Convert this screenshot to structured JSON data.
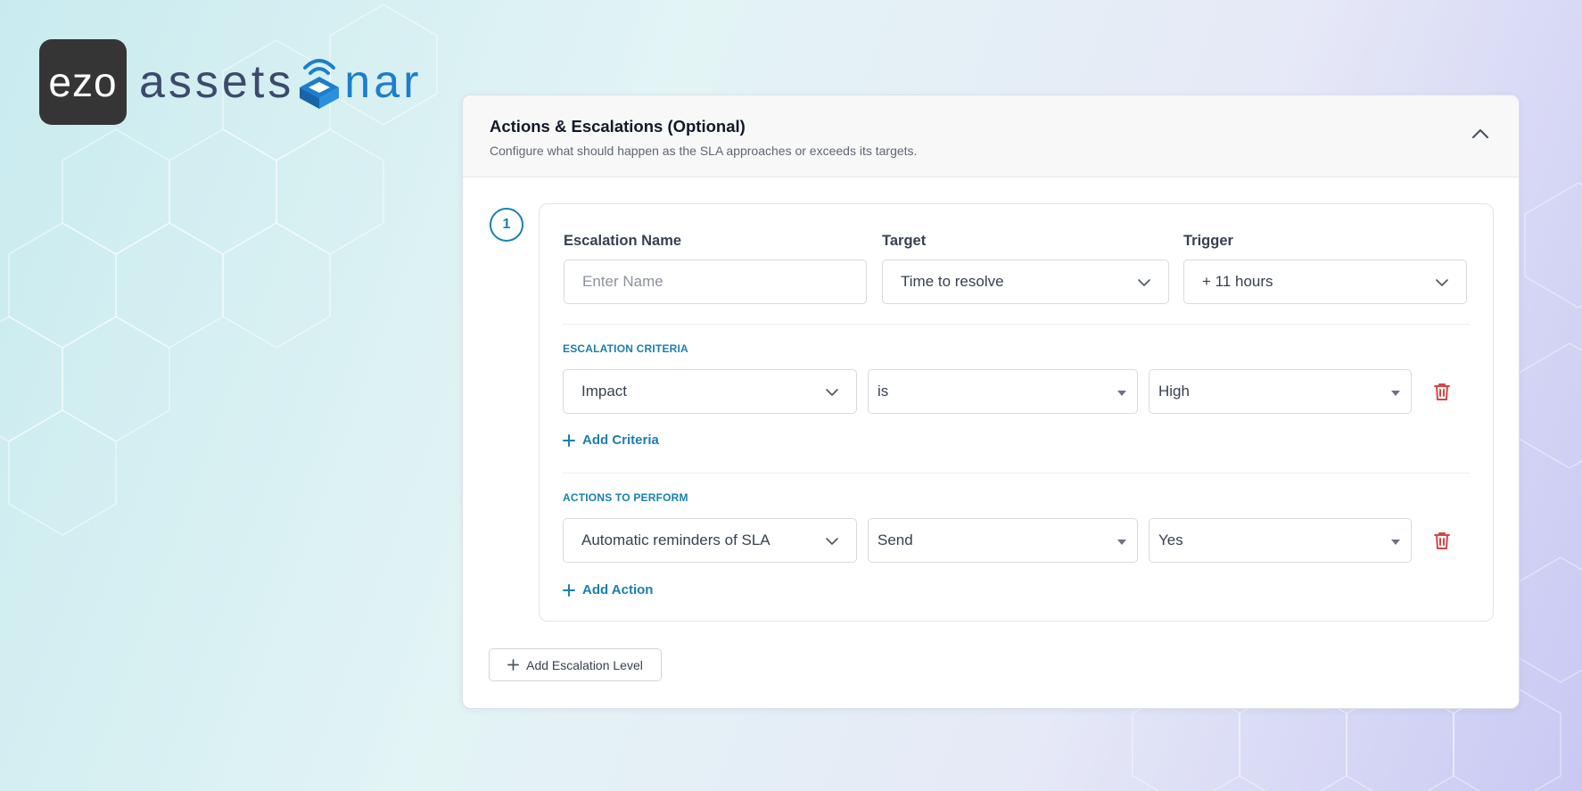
{
  "brand": {
    "tile_text": "ezo",
    "word_left": "assets",
    "word_right": "nar",
    "accent": "#1b7fcc",
    "icons": {
      "sonar": "sonar-wave-icon"
    }
  },
  "section": {
    "title": "Actions & Escalations (Optional)",
    "subtitle": "Configure what should happen as the SLA approaches or exceeds its targets.",
    "collapse_icon": "chevron-up-icon"
  },
  "escalation": {
    "level_number": "1",
    "name_label": "Escalation Name",
    "name_placeholder": "Enter Name",
    "name_value": "",
    "target_label": "Target",
    "target_value": "Time to resolve",
    "trigger_label": "Trigger",
    "trigger_value": "+ 11 hours",
    "criteria_title": "ESCALATION CRITERIA",
    "criteria": [
      {
        "field": "Impact",
        "operator": "is",
        "value": "High"
      }
    ],
    "add_criteria_label": "Add Criteria",
    "actions_title": "ACTIONS TO PERFORM",
    "actions": [
      {
        "action": "Automatic reminders of SLA",
        "operation": "Send",
        "value": "Yes"
      }
    ],
    "add_action_label": "Add Action"
  },
  "add_level_label": "Add Escalation Level",
  "colors": {
    "accent": "#1a7fae",
    "danger": "#d64545",
    "logo_tile": "#353535"
  }
}
